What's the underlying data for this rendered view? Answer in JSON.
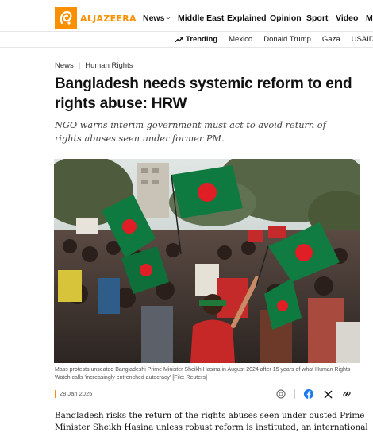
{
  "nav": {
    "logo_text": "ALJAZEERA",
    "links": [
      "News",
      "Middle East",
      "Explained",
      "Opinion",
      "Sport",
      "Video",
      "M"
    ],
    "accent_color": "#fa9000"
  },
  "trending": {
    "label": "Trending",
    "items": [
      "Mexico",
      "Donald Trump",
      "Gaza",
      "USAID"
    ]
  },
  "article": {
    "breadcrumb": [
      "News",
      "Human Rights"
    ],
    "title": "Bangladesh needs systemic reform to end rights abuse: HRW",
    "subtitle": "NGO warns interim government must act to avoid return of rights abuses seen under former PM.",
    "caption": "Mass protests unseated Bangladeshi Prime Minister Sheikh Hasina in August 2024 after 15 years of what Human Rights Watch calls 'increasingly entrenched autocracy' [File: Reuters]",
    "date": "28 Jan 2025",
    "body": "Bangladesh risks the return of the rights abuses seen under ousted Prime Minister Sheikh Hasina unless robust reform is instituted, an international NGO has warned.",
    "share_icons": [
      "comment-icon",
      "facebook-icon",
      "x-icon",
      "link-icon"
    ]
  }
}
